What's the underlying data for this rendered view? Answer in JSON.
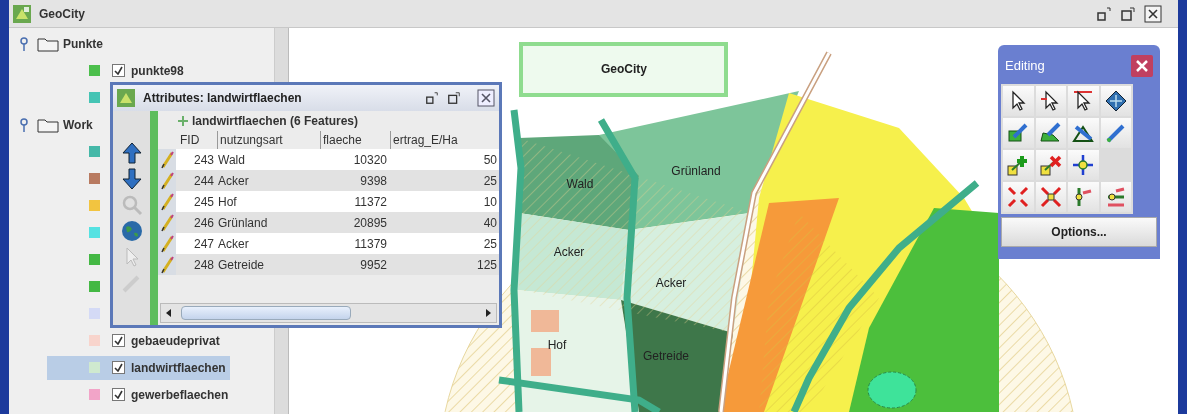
{
  "window": {
    "title": "GeoCity"
  },
  "layer_tree": [
    {
      "label": "Punkte",
      "expanded": true,
      "children": [
        {
          "label": "punkte98",
          "color": "#4cbf4c",
          "checked": true,
          "selected": false
        },
        {
          "color": "#45c4b4"
        }
      ]
    },
    {
      "label": "Work",
      "expanded": true,
      "children": [
        {
          "color": "#45b8a8"
        },
        {
          "color": "#b87a60"
        },
        {
          "color": "#f2c440"
        },
        {
          "color": "#55e2e2"
        },
        {
          "color": "#44b844"
        },
        {
          "color": "#44b844"
        },
        {
          "color": "#d4daf6"
        },
        {
          "label": "gebaeudeprivat",
          "color": "#f8d4cc",
          "checked": true,
          "selected": false
        },
        {
          "label": "landwirtflaechen",
          "color": "#cfe9cf",
          "checked": true,
          "selected": true
        },
        {
          "label": "gewerbeflaechen",
          "color": "#f2a4c8",
          "checked": true,
          "selected": false
        }
      ]
    }
  ],
  "attributes_window": {
    "title": "Attributes: landwirtflaechen",
    "table_title": "landwirtflaechen (6 Features)",
    "columns": [
      "FID",
      "nutzungsart",
      "flaeche",
      "ertrag_E/Ha"
    ],
    "rows": [
      [
        "243",
        "Wald",
        "10320",
        "50"
      ],
      [
        "244",
        "Acker",
        "9398",
        "25"
      ],
      [
        "245",
        "Hof",
        "11372",
        "10"
      ],
      [
        "246",
        "Grünland",
        "20895",
        "40"
      ],
      [
        "247",
        "Acker",
        "11379",
        "25"
      ],
      [
        "248",
        "Getreide",
        "9952",
        "125"
      ]
    ]
  },
  "map": {
    "title_label": "GeoCity",
    "labels": [
      "Wald",
      "Grünland",
      "Acker",
      "Acker",
      "Hof",
      "Getreide"
    ]
  },
  "editing_palette": {
    "title": "Editing",
    "options_button": "Options..."
  }
}
